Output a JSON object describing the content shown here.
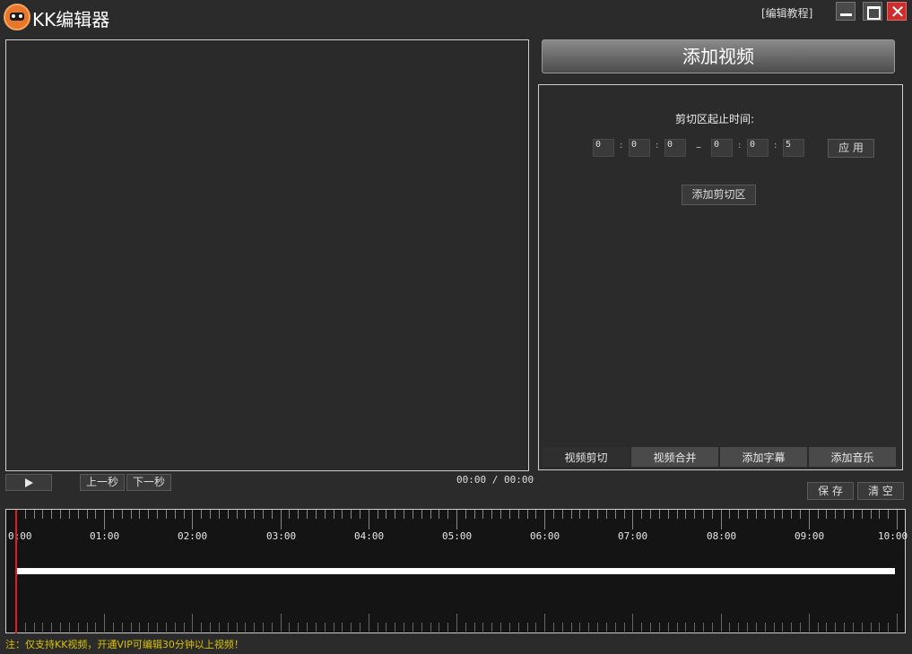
{
  "app": {
    "title": "KK编辑器",
    "tutorial_link": "[编辑教程]"
  },
  "window_controls": {
    "minimize": "minimize-icon",
    "maximize": "maximize-icon",
    "close": "close-icon"
  },
  "player": {
    "play_icon": "play-icon",
    "prev_second": "上一秒",
    "next_second": "下一秒",
    "time_display": "00:00 / 00:00"
  },
  "add_video_label": "添加视频",
  "cut_panel": {
    "label": "剪切区起止时间:",
    "start": {
      "h": "0",
      "m": "0",
      "s": "0"
    },
    "dash": "–",
    "end": {
      "h": "0",
      "m": "0",
      "s": "5"
    },
    "colon": ":",
    "apply_label": "应 用",
    "add_cut_label": "添加剪切区"
  },
  "tabs": [
    "视频剪切",
    "视频合并",
    "添加字幕",
    "添加音乐"
  ],
  "active_tab": 0,
  "actions": {
    "save": "保 存",
    "clear": "清 空"
  },
  "timeline": {
    "labels": [
      "0:00",
      "01:00",
      "02:00",
      "03:00",
      "04:00",
      "05:00",
      "06:00",
      "07:00",
      "08:00",
      "09:00",
      "10:00"
    ],
    "playhead_position": "0:00",
    "colors": {
      "playhead": "#e02020",
      "track": "#ffffff",
      "background": "#141414"
    }
  },
  "footer_note": "注：仅支持KK视频，开通VIP可编辑30分钟以上视频！"
}
